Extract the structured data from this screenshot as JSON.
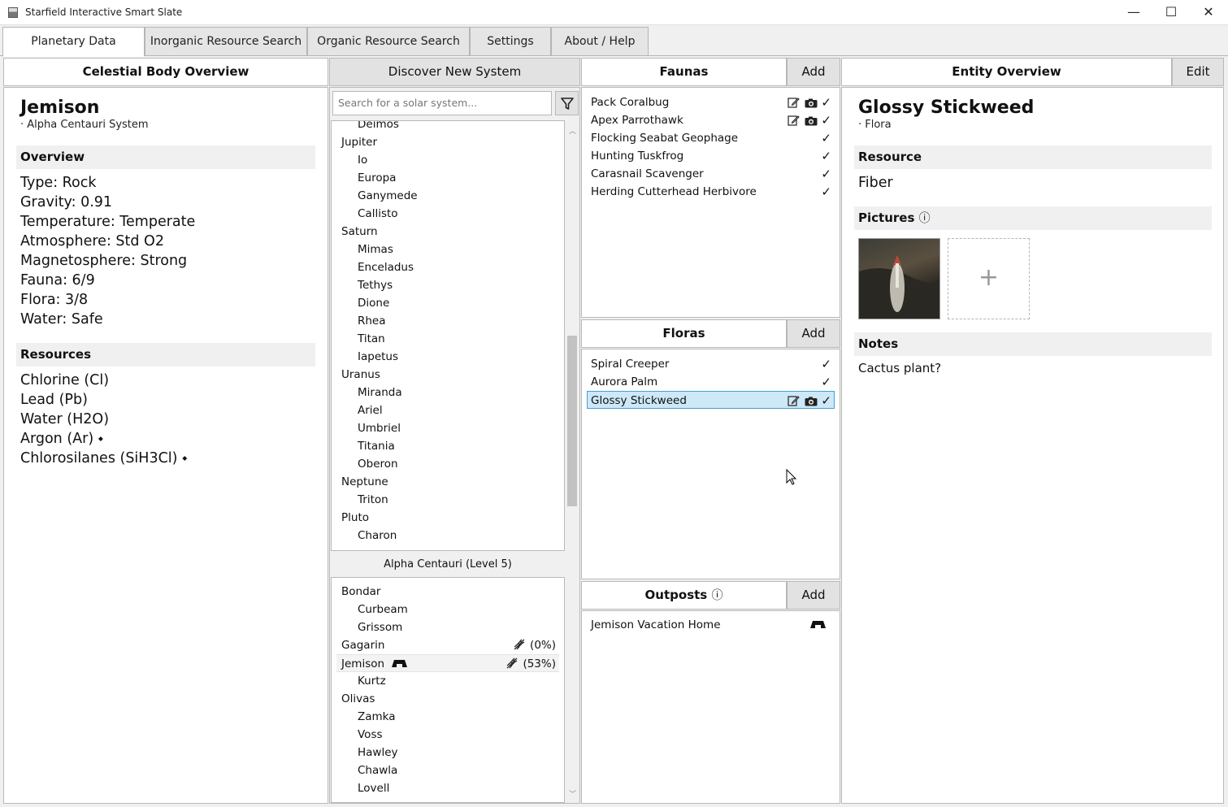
{
  "window": {
    "title": "Starfield Interactive Smart Slate",
    "minimize": "—",
    "maximize": "☐",
    "close": "✕"
  },
  "tabs": [
    {
      "label": "Planetary Data"
    },
    {
      "label": "Inorganic Resource Search"
    },
    {
      "label": "Organic Resource Search"
    },
    {
      "label": "Settings"
    },
    {
      "label": "About / Help"
    }
  ],
  "celestial": {
    "header": "Celestial Body Overview",
    "name": "Jemison",
    "system": "· Alpha Centauri System",
    "overview_title": "Overview",
    "overview": [
      "Type: Rock",
      "Gravity: 0.91",
      "Temperature: Temperate",
      "Atmosphere: Std O2",
      "Magnetosphere: Strong",
      "Fauna: 6/9",
      "Flora: 3/8",
      "Water: Safe"
    ],
    "resources_title": "Resources",
    "resources": [
      "Chlorine (Cl)",
      "Lead (Pb)",
      "Water (H2O)",
      "Argon (Ar) ⬩",
      "Chlorosilanes (SiH3Cl) ⬩"
    ]
  },
  "discover": {
    "header": "Discover New System",
    "search_placeholder": "Search for a solar system...",
    "sol_tree": [
      {
        "name": "Deimos",
        "level": 1
      },
      {
        "name": "Jupiter",
        "level": 0
      },
      {
        "name": "Io",
        "level": 1
      },
      {
        "name": "Europa",
        "level": 1
      },
      {
        "name": "Ganymede",
        "level": 1
      },
      {
        "name": "Callisto",
        "level": 1
      },
      {
        "name": "Saturn",
        "level": 0
      },
      {
        "name": "Mimas",
        "level": 1
      },
      {
        "name": "Enceladus",
        "level": 1
      },
      {
        "name": "Tethys",
        "level": 1
      },
      {
        "name": "Dione",
        "level": 1
      },
      {
        "name": "Rhea",
        "level": 1
      },
      {
        "name": "Titan",
        "level": 1
      },
      {
        "name": "Iapetus",
        "level": 1
      },
      {
        "name": "Uranus",
        "level": 0
      },
      {
        "name": "Miranda",
        "level": 1
      },
      {
        "name": "Ariel",
        "level": 1
      },
      {
        "name": "Umbriel",
        "level": 1
      },
      {
        "name": "Titania",
        "level": 1
      },
      {
        "name": "Oberon",
        "level": 1
      },
      {
        "name": "Neptune",
        "level": 0
      },
      {
        "name": "Triton",
        "level": 1
      },
      {
        "name": "Pluto",
        "level": 0
      },
      {
        "name": "Charon",
        "level": 1
      }
    ],
    "system_title": "Alpha Centauri (Level 5)",
    "system_tree": [
      {
        "name": "Bondar",
        "level": 0
      },
      {
        "name": "Curbeam",
        "level": 1
      },
      {
        "name": "Grissom",
        "level": 1
      },
      {
        "name": "Gagarin",
        "level": 0,
        "progress": "(0%)"
      },
      {
        "name": "Jemison",
        "level": 0,
        "progress": "(53%)",
        "outpost": true,
        "selected": true
      },
      {
        "name": "Kurtz",
        "level": 1
      },
      {
        "name": "Olivas",
        "level": 0
      },
      {
        "name": "Zamka",
        "level": 1
      },
      {
        "name": "Voss",
        "level": 1
      },
      {
        "name": "Hawley",
        "level": 1
      },
      {
        "name": "Chawla",
        "level": 1
      },
      {
        "name": "Lovell",
        "level": 1
      }
    ]
  },
  "faunas": {
    "header": "Faunas",
    "add": "Add",
    "items": [
      {
        "name": "Pack Coralbug",
        "note": true,
        "photo": true,
        "check": "✓"
      },
      {
        "name": "Apex Parrothawk",
        "note": true,
        "photo": true,
        "check": "✓"
      },
      {
        "name": "Flocking Seabat Geophage",
        "check": "✓"
      },
      {
        "name": "Hunting Tuskfrog",
        "check": "✓"
      },
      {
        "name": "Carasnail Scavenger",
        "check": "✓"
      },
      {
        "name": "Herding Cutterhead Herbivore",
        "check": "✓"
      }
    ]
  },
  "floras": {
    "header": "Floras",
    "add": "Add",
    "items": [
      {
        "name": "Spiral Creeper",
        "check": "✓"
      },
      {
        "name": "Aurora Palm",
        "check": "✓"
      },
      {
        "name": "Glossy Stickweed",
        "note": true,
        "photo": true,
        "check": "✓",
        "selected": true
      }
    ]
  },
  "outposts": {
    "header": "Outposts",
    "info": "ⓘ",
    "add": "Add",
    "items": [
      {
        "name": "Jemison Vacation Home"
      }
    ]
  },
  "entity": {
    "header": "Entity Overview",
    "edit": "Edit",
    "name": "Glossy Stickweed",
    "kind": "· Flora",
    "resource_title": "Resource",
    "resource": "Fiber",
    "pictures_title": "Pictures",
    "pictures_info": "ⓘ",
    "add_picture": "+",
    "notes_title": "Notes",
    "notes": "Cactus plant?"
  },
  "colors": {
    "selection_bg": "#cde8f7",
    "selection_border": "#46a0d6",
    "section_bg": "#f0f0f0",
    "button_bg": "#e2e2e2"
  }
}
